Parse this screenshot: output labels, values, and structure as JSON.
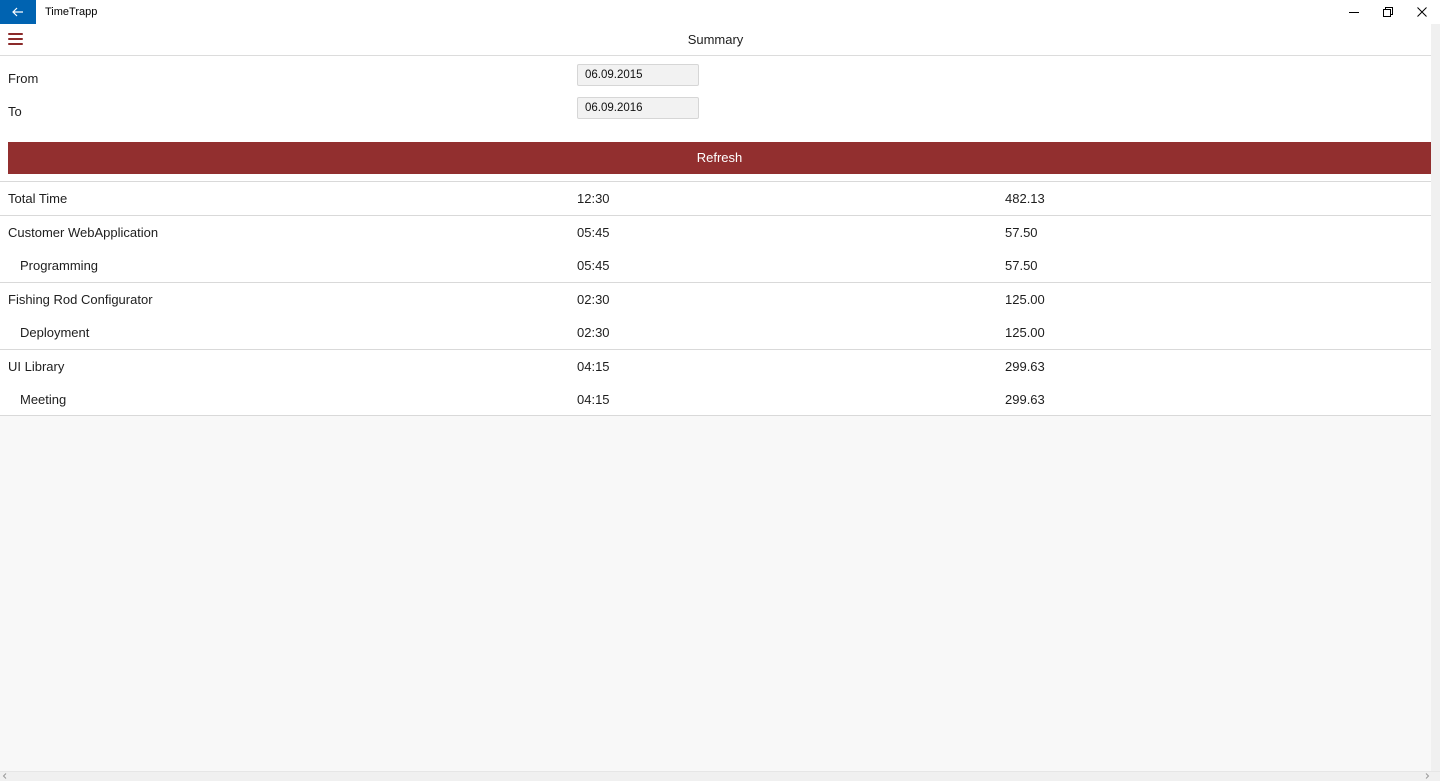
{
  "window": {
    "title": "TimeTrapp",
    "controls": [
      "minimize-icon",
      "restore-icon",
      "close-icon"
    ]
  },
  "header": {
    "title": "Summary"
  },
  "filter": {
    "from_label": "From",
    "from_value": "06.09.2015",
    "to_label": "To",
    "to_value": "06.09.2016",
    "refresh_label": "Refresh"
  },
  "summary": {
    "total": {
      "name": "Total Time",
      "time": "12:30",
      "amount": "482.13"
    },
    "groups": [
      {
        "name": "Customer WebApplication",
        "time": "05:45",
        "amount": "57.50",
        "items": [
          {
            "name": "Programming",
            "time": "05:45",
            "amount": "57.50"
          }
        ]
      },
      {
        "name": "Fishing Rod Configurator",
        "time": "02:30",
        "amount": "125.00",
        "items": [
          {
            "name": "Deployment",
            "time": "02:30",
            "amount": "125.00"
          }
        ]
      },
      {
        "name": "UI Library",
        "time": "04:15",
        "amount": "299.63",
        "items": [
          {
            "name": "Meeting",
            "time": "04:15",
            "amount": "299.63"
          }
        ]
      }
    ]
  },
  "colors": {
    "accent": "#922f2f",
    "back_button": "#0063b1",
    "hamburger": "#8b2a2a"
  }
}
